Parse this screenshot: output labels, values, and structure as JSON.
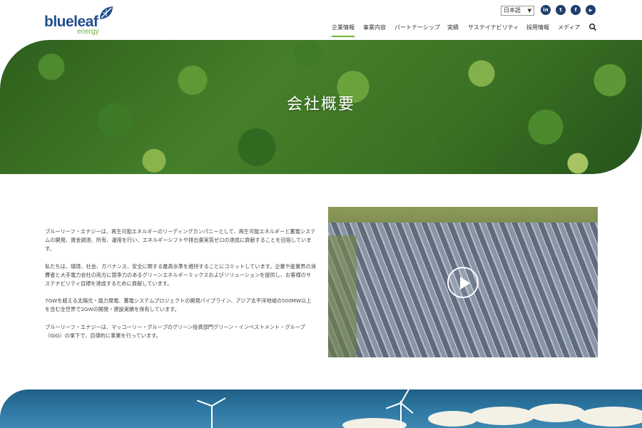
{
  "brand": {
    "logo_text": "blueleaf",
    "logo_sub": "energy",
    "colors": {
      "navy": "#1f4e8c",
      "green": "#6fb436"
    }
  },
  "header": {
    "language": "日本語",
    "social": [
      {
        "icon": "linkedin-icon",
        "glyph": "in"
      },
      {
        "icon": "twitter-icon",
        "glyph": "t"
      },
      {
        "icon": "facebook-icon",
        "glyph": "f"
      },
      {
        "icon": "youtube-icon",
        "glyph": "▶"
      }
    ],
    "nav": [
      {
        "label": "企業情報",
        "active": true
      },
      {
        "label": "事業内容",
        "active": false
      },
      {
        "label": "パートナーシップ",
        "active": false
      },
      {
        "label": "実績",
        "active": false
      },
      {
        "label": "サステイナビリティ",
        "active": false
      },
      {
        "label": "採用情報",
        "active": false
      },
      {
        "label": "メディア",
        "active": false
      }
    ],
    "search_icon": "search-icon"
  },
  "hero": {
    "title": "会社概要"
  },
  "intro": {
    "paragraphs": [
      "ブルーリーフ・エナジーは、再生可能エネルギーのリーディングカンパニーとして、再生可能エネルギーと蓄電システムの開発、資金調達、所有、運用を行い、エネルギーシフトや排出量実質ゼロの達成に貢献することを目指しています。",
      "私たちは、環境、社会、ガバナンス、安全に関する最高水準を維持することにコミットしています。企業や産業界の消費者と大手電力会社の両方に競争力のあるグリーンエネルギーミックスおよびソリューションを提供し、お客様のサステナビリティ目標を達成するために貢献しています。",
      "7GWを超える太陽光・風力発電、蓄電システムプロジェクトの開発パイプライン、アジア太平洋地域の500MW以上を含む全世界で2GWの開発・建設実績を保有しています。",
      "ブルーリーフ・エナジーは、マッコーリー・グループのグリーン投資部門グリーン・インベストメント・グループ（GIG）の傘下で、自律的に事業を行っています。"
    ]
  },
  "video": {
    "play_icon": "play-icon"
  }
}
